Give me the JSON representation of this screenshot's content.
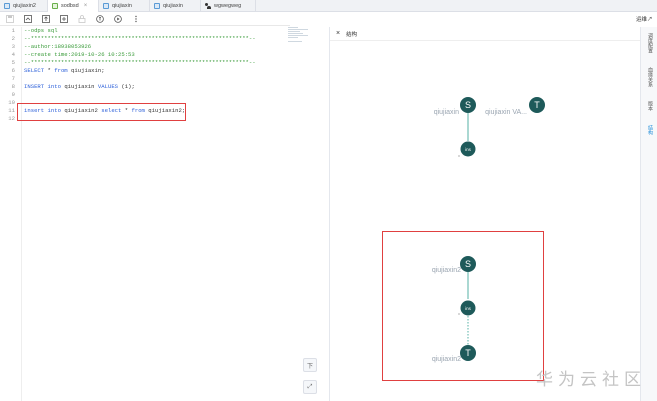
{
  "tabs": [
    {
      "label": "qiujiaxin2",
      "icon": "file-icon",
      "active": false
    },
    {
      "label": "sodbsd",
      "icon": "odps-file-icon",
      "active": true
    },
    {
      "label": "qiujiaxin",
      "icon": "file-icon",
      "active": false
    },
    {
      "label": "qiujiaxin",
      "icon": "file-icon",
      "active": false
    },
    {
      "label": "wgwegweg",
      "icon": "people-icon",
      "active": false
    }
  ],
  "tab_close_glyph": "×",
  "toolbar": [
    "save",
    "save-as",
    "submit",
    "deploy",
    "edit-lock",
    "run-params",
    "run",
    "more"
  ],
  "editor": {
    "lines": [
      {
        "n": "1",
        "text": "--odps sql",
        "kind": "comment"
      },
      {
        "n": "2",
        "text": "--*****************************************************************--",
        "kind": "comment"
      },
      {
        "n": "3",
        "text": "--author:18938053926",
        "kind": "comment"
      },
      {
        "n": "4",
        "text": "--create time:2019-10-26 10:25:53",
        "kind": "comment"
      },
      {
        "n": "5",
        "text": "--*****************************************************************--",
        "kind": "comment"
      },
      {
        "n": "6",
        "text": "SELECT * from qiujiaxin;",
        "kind": "code"
      },
      {
        "n": "7",
        "text": "",
        "kind": "code"
      },
      {
        "n": "8",
        "text": "INSERT into qiujiaxin VALUES (1);",
        "kind": "code"
      },
      {
        "n": "9",
        "text": "",
        "kind": "code"
      },
      {
        "n": "10",
        "text": "",
        "kind": "code"
      },
      {
        "n": "11",
        "text": "insert into qiujiaxin2 select * from qiujiaxin2;",
        "kind": "code"
      },
      {
        "n": "12",
        "text": "",
        "kind": "code"
      }
    ]
  },
  "side_buttons": {
    "down": "下",
    "fit": "⤢"
  },
  "panel": {
    "close": "×",
    "title": "结构",
    "top_right": "运维↗"
  },
  "graph": {
    "nodes": [
      {
        "letter": "S",
        "label": "qiujiaxin"
      },
      {
        "letter": "T",
        "label": "qiujiaxin VA..."
      },
      {
        "letter": "ins",
        "label": ""
      },
      {
        "letter": "S",
        "label": "qiujiaxin2"
      },
      {
        "letter": "ins",
        "label": ""
      },
      {
        "letter": "T",
        "label": "qiujiaxin2"
      }
    ]
  },
  "rail": [
    "调度配置",
    "血缘关系",
    "版本",
    "结构"
  ],
  "watermark": "华为云社区",
  "colors": {
    "node": "#1e5a5a",
    "edge": "#2a9d8f",
    "highlight": "#e04040",
    "comment": "#3a9b3a",
    "keyword": "#2b5fd9"
  }
}
